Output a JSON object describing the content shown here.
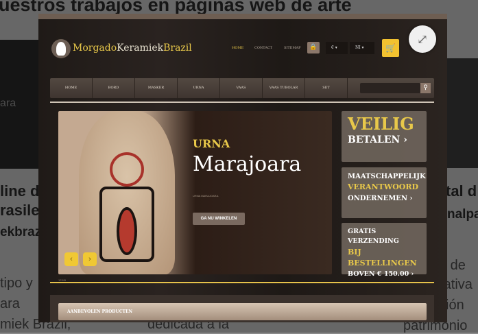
{
  "background": {
    "heading": "uestros trabajos en páginas web de arte",
    "left_col": [
      "line d",
      "rasile",
      "ekbraz"
    ],
    "left_body": [
      "tipo y",
      "ara",
      "miek Brazil,"
    ],
    "left_thumb_text": "ara",
    "mid_body": "dedicada a la",
    "right_col": [
      "tal d",
      "nalpa"
    ],
    "right_body": [
      "o de",
      "rativa",
      "ción",
      "patrimonio"
    ]
  },
  "site": {
    "logo": {
      "part1": "Morgado",
      "part2": "Keramiek",
      "part3": "Brazil"
    },
    "top_links": [
      "HOME",
      "CONTACT",
      "SITEMAP"
    ],
    "currency": "€ ▾",
    "language": "NI ▾",
    "nav": [
      "HOME",
      "BORD",
      "MASKER",
      "URNA",
      "VAAS",
      "VAAS TUBOLAR",
      "SET"
    ],
    "slide": {
      "category": "URNA",
      "title": "Marajoara",
      "caption": "URNA MARAJOARA.",
      "button": "GA NU WINKELEN"
    },
    "promos": [
      {
        "l1": "VEILIG",
        "l2": "BETALEN ›"
      },
      {
        "l1": "MAATSCHAPPELIJK",
        "l2": "VERANTWOORD",
        "l3": "ONDERNEMEN ›"
      },
      {
        "l1": "GRATIS VERZENDING",
        "l2": "BIJ BESTELLINGEN",
        "l3": "BOVEN € 150.00 ›"
      }
    ],
    "small_text": "12345",
    "featured": "AANBEVOLEN PRODUCTEN"
  },
  "colors": {
    "accent": "#e8c84a",
    "cart": "#f2c230"
  }
}
